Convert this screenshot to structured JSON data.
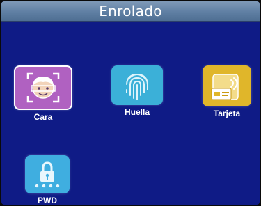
{
  "header": {
    "title": "Enrolado"
  },
  "tiles": [
    {
      "label": "Cara",
      "icon": "face-icon",
      "color": "#b061c1"
    },
    {
      "label": "Huella",
      "icon": "fingerprint-icon",
      "color": "#3bb0d8"
    },
    {
      "label": "Tarjeta",
      "icon": "card-icon",
      "color": "#e0b62a"
    },
    {
      "label": "PWD",
      "icon": "lock-icon",
      "color": "#3faee0"
    }
  ],
  "colors": {
    "background": "#0f1b86",
    "titlebar": "#6a87ab",
    "text": "#ffffff"
  }
}
